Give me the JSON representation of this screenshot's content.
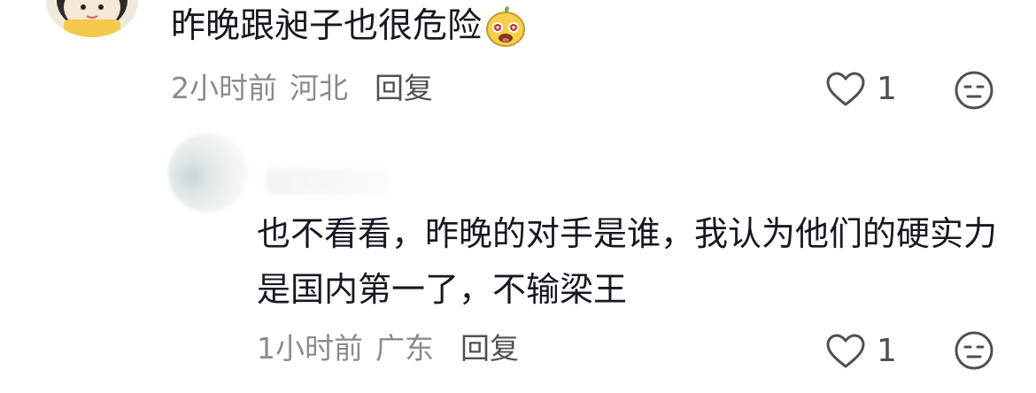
{
  "comments": [
    {
      "text": "昨晚跟昶子也很危险",
      "emoji": "bean-emoji",
      "time": "2小时前",
      "location": "河北",
      "reply_label": "回复",
      "likes": "1"
    },
    {
      "text": "也不看看，昨晚的对手是谁，我认为他们的硬实力是国内第一了，不输梁王",
      "time": "1小时前",
      "location": "广东",
      "reply_label": "回复",
      "likes": "1"
    }
  ],
  "colors": {
    "text": "#161823",
    "meta": "#8a8b91",
    "reply": "#4f5055"
  }
}
